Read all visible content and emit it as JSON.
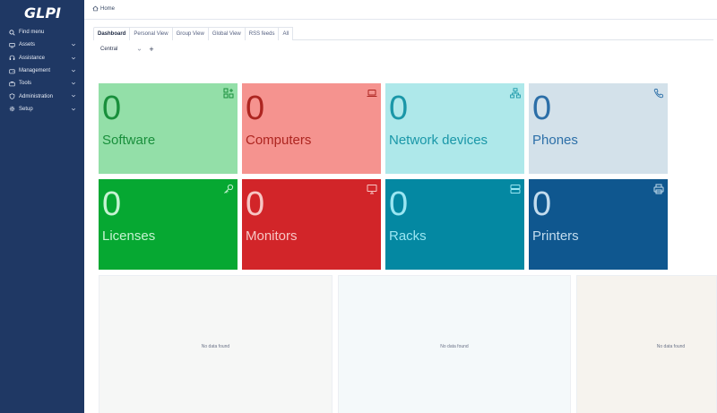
{
  "app": {
    "logo": "GLPI"
  },
  "sidebar": {
    "items": [
      {
        "label": "Find menu",
        "icon": "search-icon",
        "has_chevron": false
      },
      {
        "label": "Assets",
        "icon": "assets-icon",
        "has_chevron": true
      },
      {
        "label": "Assistance",
        "icon": "headset-icon",
        "has_chevron": true
      },
      {
        "label": "Management",
        "icon": "wallet-icon",
        "has_chevron": true
      },
      {
        "label": "Tools",
        "icon": "briefcase-icon",
        "has_chevron": true
      },
      {
        "label": "Administration",
        "icon": "shield-icon",
        "has_chevron": true
      },
      {
        "label": "Setup",
        "icon": "gear-icon",
        "has_chevron": true
      }
    ]
  },
  "breadcrumb": {
    "home": "Home"
  },
  "tabs": [
    "Dashboard",
    "Personal View",
    "Group View",
    "Global View",
    "RSS feeds",
    "All"
  ],
  "dashboard_select": {
    "value": "Central"
  },
  "add_button": "+",
  "tiles": [
    {
      "count": "0",
      "label": "Software",
      "icon": "software-icon",
      "bg": "#93dfa8",
      "fg": "#198f3c"
    },
    {
      "count": "0",
      "label": "Computers",
      "icon": "laptop-icon",
      "bg": "#f5938f",
      "fg": "#ad2520"
    },
    {
      "count": "0",
      "label": "Network devices",
      "icon": "network-icon",
      "bg": "#aee8ea",
      "fg": "#1a97a8"
    },
    {
      "count": "0",
      "label": "Phones",
      "icon": "phone-icon",
      "bg": "#d3e1ea",
      "fg": "#2c6fa8"
    },
    {
      "count": "0",
      "label": "Licenses",
      "icon": "key-icon",
      "bg": "#06a832",
      "fg": "#c6f3d2"
    },
    {
      "count": "0",
      "label": "Monitors",
      "icon": "monitor-icon",
      "bg": "#d22529",
      "fg": "#f7c6c4"
    },
    {
      "count": "0",
      "label": "Racks",
      "icon": "server-icon",
      "bg": "#0488a2",
      "fg": "#9ae6f2"
    },
    {
      "count": "0",
      "label": "Printers",
      "icon": "printer-icon",
      "bg": "#0f578f",
      "fg": "#c3dcee"
    }
  ],
  "panels": [
    {
      "text": "No data found",
      "bg": "#f6f7f6"
    },
    {
      "text": "No data found",
      "bg": "#f4f9fa"
    },
    {
      "text": "No data found",
      "bg": "#f6f3ee"
    }
  ]
}
